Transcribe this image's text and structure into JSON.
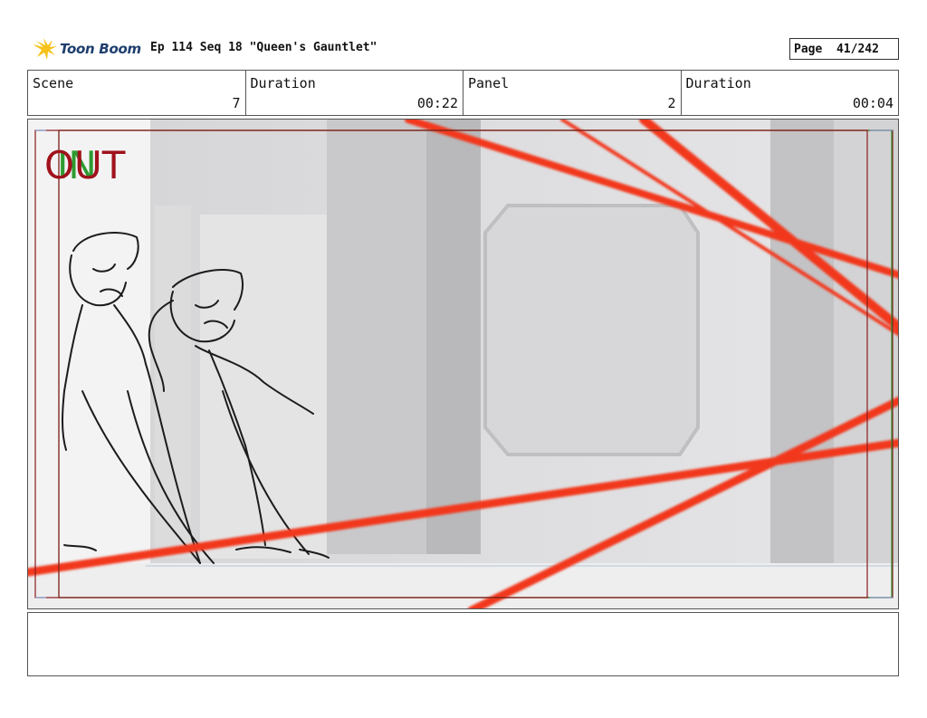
{
  "header": {
    "logo_text": "Toon Boom",
    "title": "Ep 114 Seq 18 \"Queen's Gauntlet\"",
    "page_label": "Page",
    "page_value": "41/242"
  },
  "info": {
    "scene_label": "Scene",
    "scene_value": "7",
    "scene_duration_label": "Duration",
    "scene_duration_value": "00:22",
    "panel_label": "Panel",
    "panel_value": "2",
    "panel_duration_label": "Duration",
    "panel_duration_value": "00:04"
  },
  "panel_image": {
    "in_marker": "IN",
    "out_marker": "OUT",
    "laser_color": "#f2391e",
    "camera_out_color": "#8a1a1a",
    "camera_in_color": "#2e8b2e"
  },
  "notes": {
    "text": ""
  }
}
